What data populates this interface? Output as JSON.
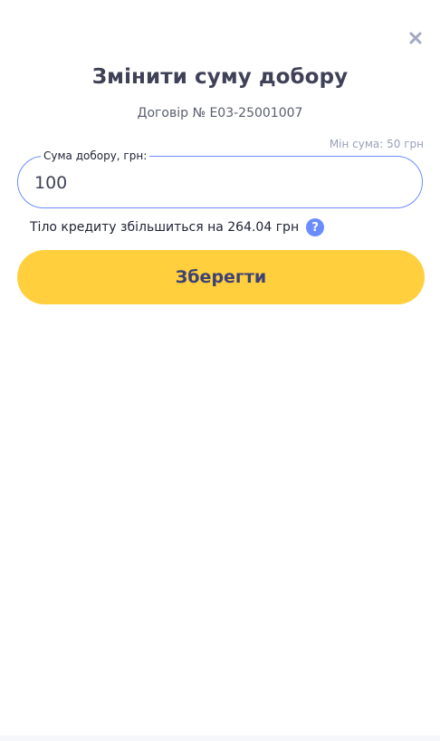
{
  "modal": {
    "title": "Змінити суму добору",
    "contract_label": "Договір № Е03-25001007",
    "min_sum_label": "Мін сума: 50 грн",
    "field": {
      "legend": "Сума добору, грн:",
      "value": "100"
    },
    "info_text": "Тіло кредиту збільшиться на 264.04 грн",
    "help_icon_glyph": "?",
    "save_label": "Зберегти"
  },
  "icons": {
    "close": "close-icon",
    "help": "question-circle-icon"
  },
  "colors": {
    "accent": "#6b8cff",
    "button_bg": "#ffcf3d",
    "button_text": "#3d4275",
    "title": "#3f4257",
    "close_icon": "#a3a9c2"
  }
}
